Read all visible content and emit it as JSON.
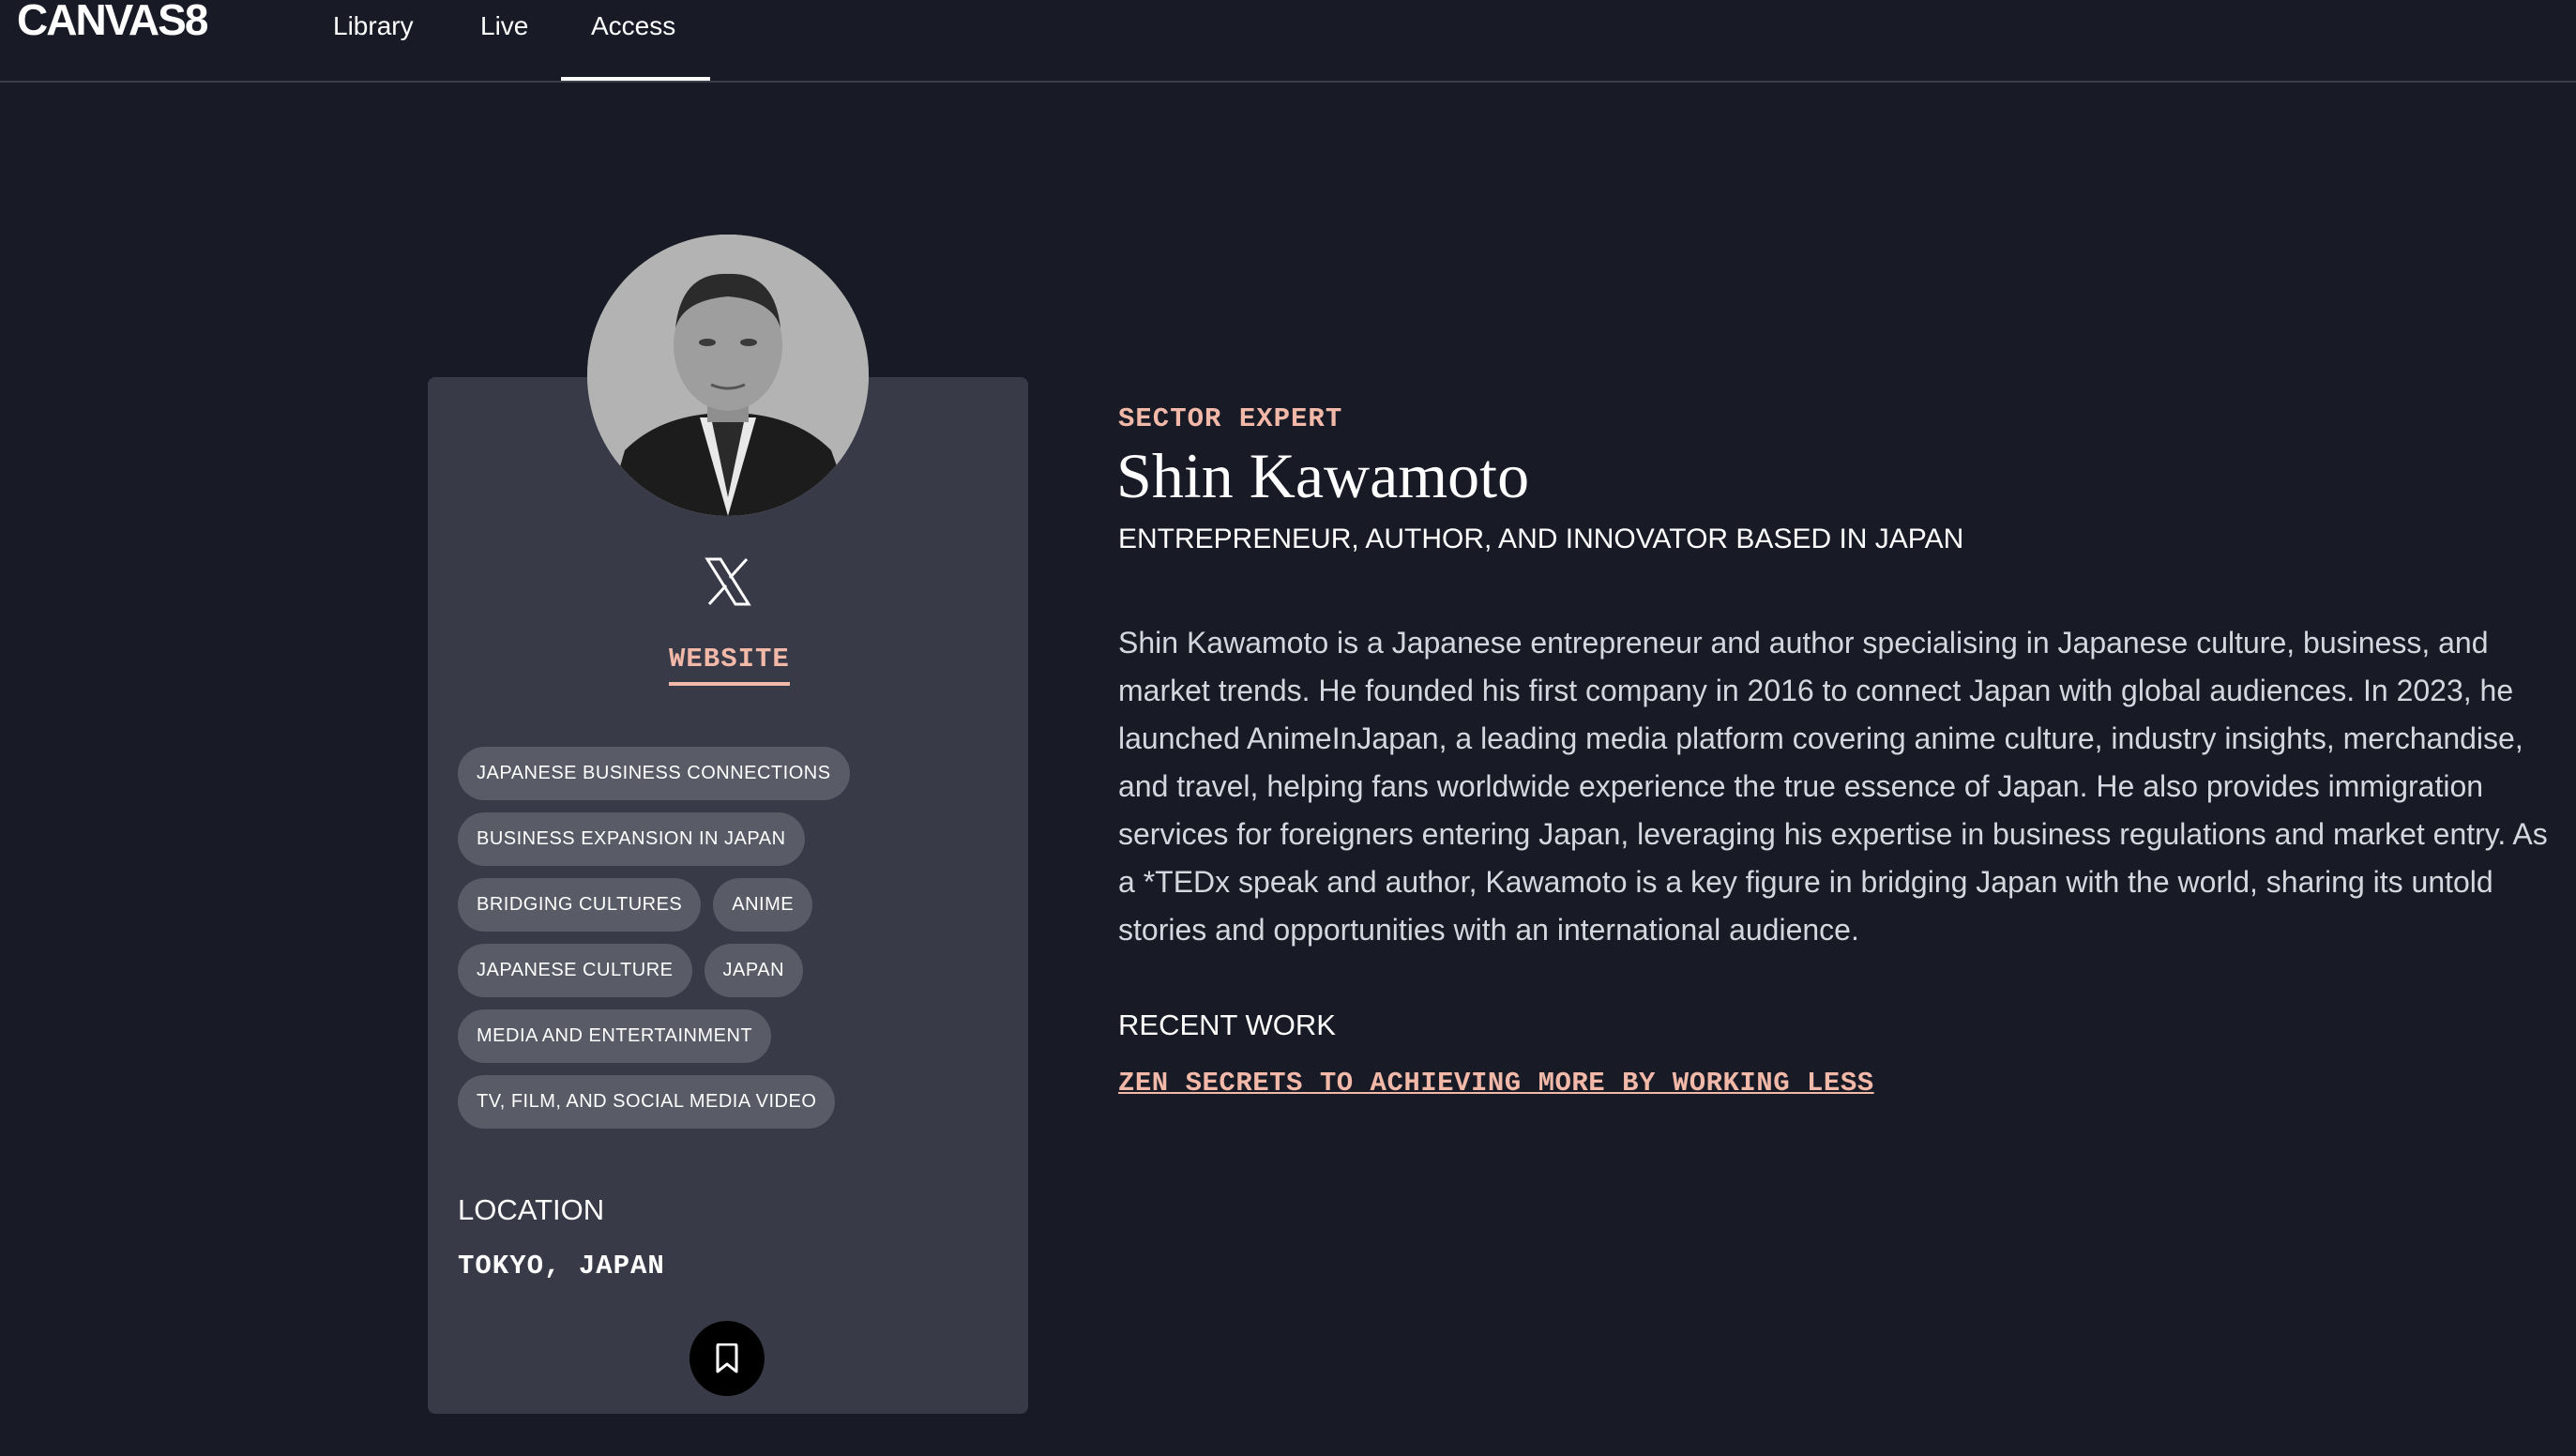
{
  "nav": {
    "logo": "CANVAS8",
    "items": [
      {
        "label": "Library"
      },
      {
        "label": "Live"
      },
      {
        "label": "Access"
      }
    ],
    "active": "Access"
  },
  "profile": {
    "social_icon": "x-icon",
    "website_label": "WEBSITE",
    "tags": [
      "JAPANESE BUSINESS CONNECTIONS",
      "BUSINESS EXPANSION IN JAPAN",
      "BRIDGING CULTURES",
      "ANIME",
      "JAPANESE CULTURE",
      "JAPAN",
      "MEDIA AND ENTERTAINMENT",
      "TV, FILM, AND SOCIAL MEDIA VIDEO"
    ],
    "location_label": "LOCATION",
    "location_value": "TOKYO, JAPAN",
    "bookmark_icon": "bookmark-icon"
  },
  "main": {
    "role": "SECTOR EXPERT",
    "name": "Shin Kawamoto",
    "subtitle": "ENTREPRENEUR, AUTHOR, AND INNOVATOR BASED IN JAPAN",
    "bio": "Shin Kawamoto is a Japanese entrepreneur and author specialising in Japanese culture, business, and market trends. He founded his first company in 2016 to connect Japan with global audiences. In 2023, he launched AnimeInJapan, a leading media platform covering anime culture, industry insights, merchandise, and travel, helping fans worldwide experience the true essence of Japan. He also provides immigration services for foreigners entering Japan, leveraging his expertise in business regulations and market entry. As a *TEDx speak and author, Kawamoto is a key figure in bridging Japan with the world, sharing its untold stories and opportunities with an international audience.",
    "recent_work_label": "RECENT WORK",
    "recent_work_link": "ZEN SECRETS TO ACHIEVING MORE BY WORKING LESS"
  },
  "colors": {
    "background": "#181a26",
    "card": "#383a48",
    "tag": "#595b66",
    "accent": "#f2b8a8"
  }
}
